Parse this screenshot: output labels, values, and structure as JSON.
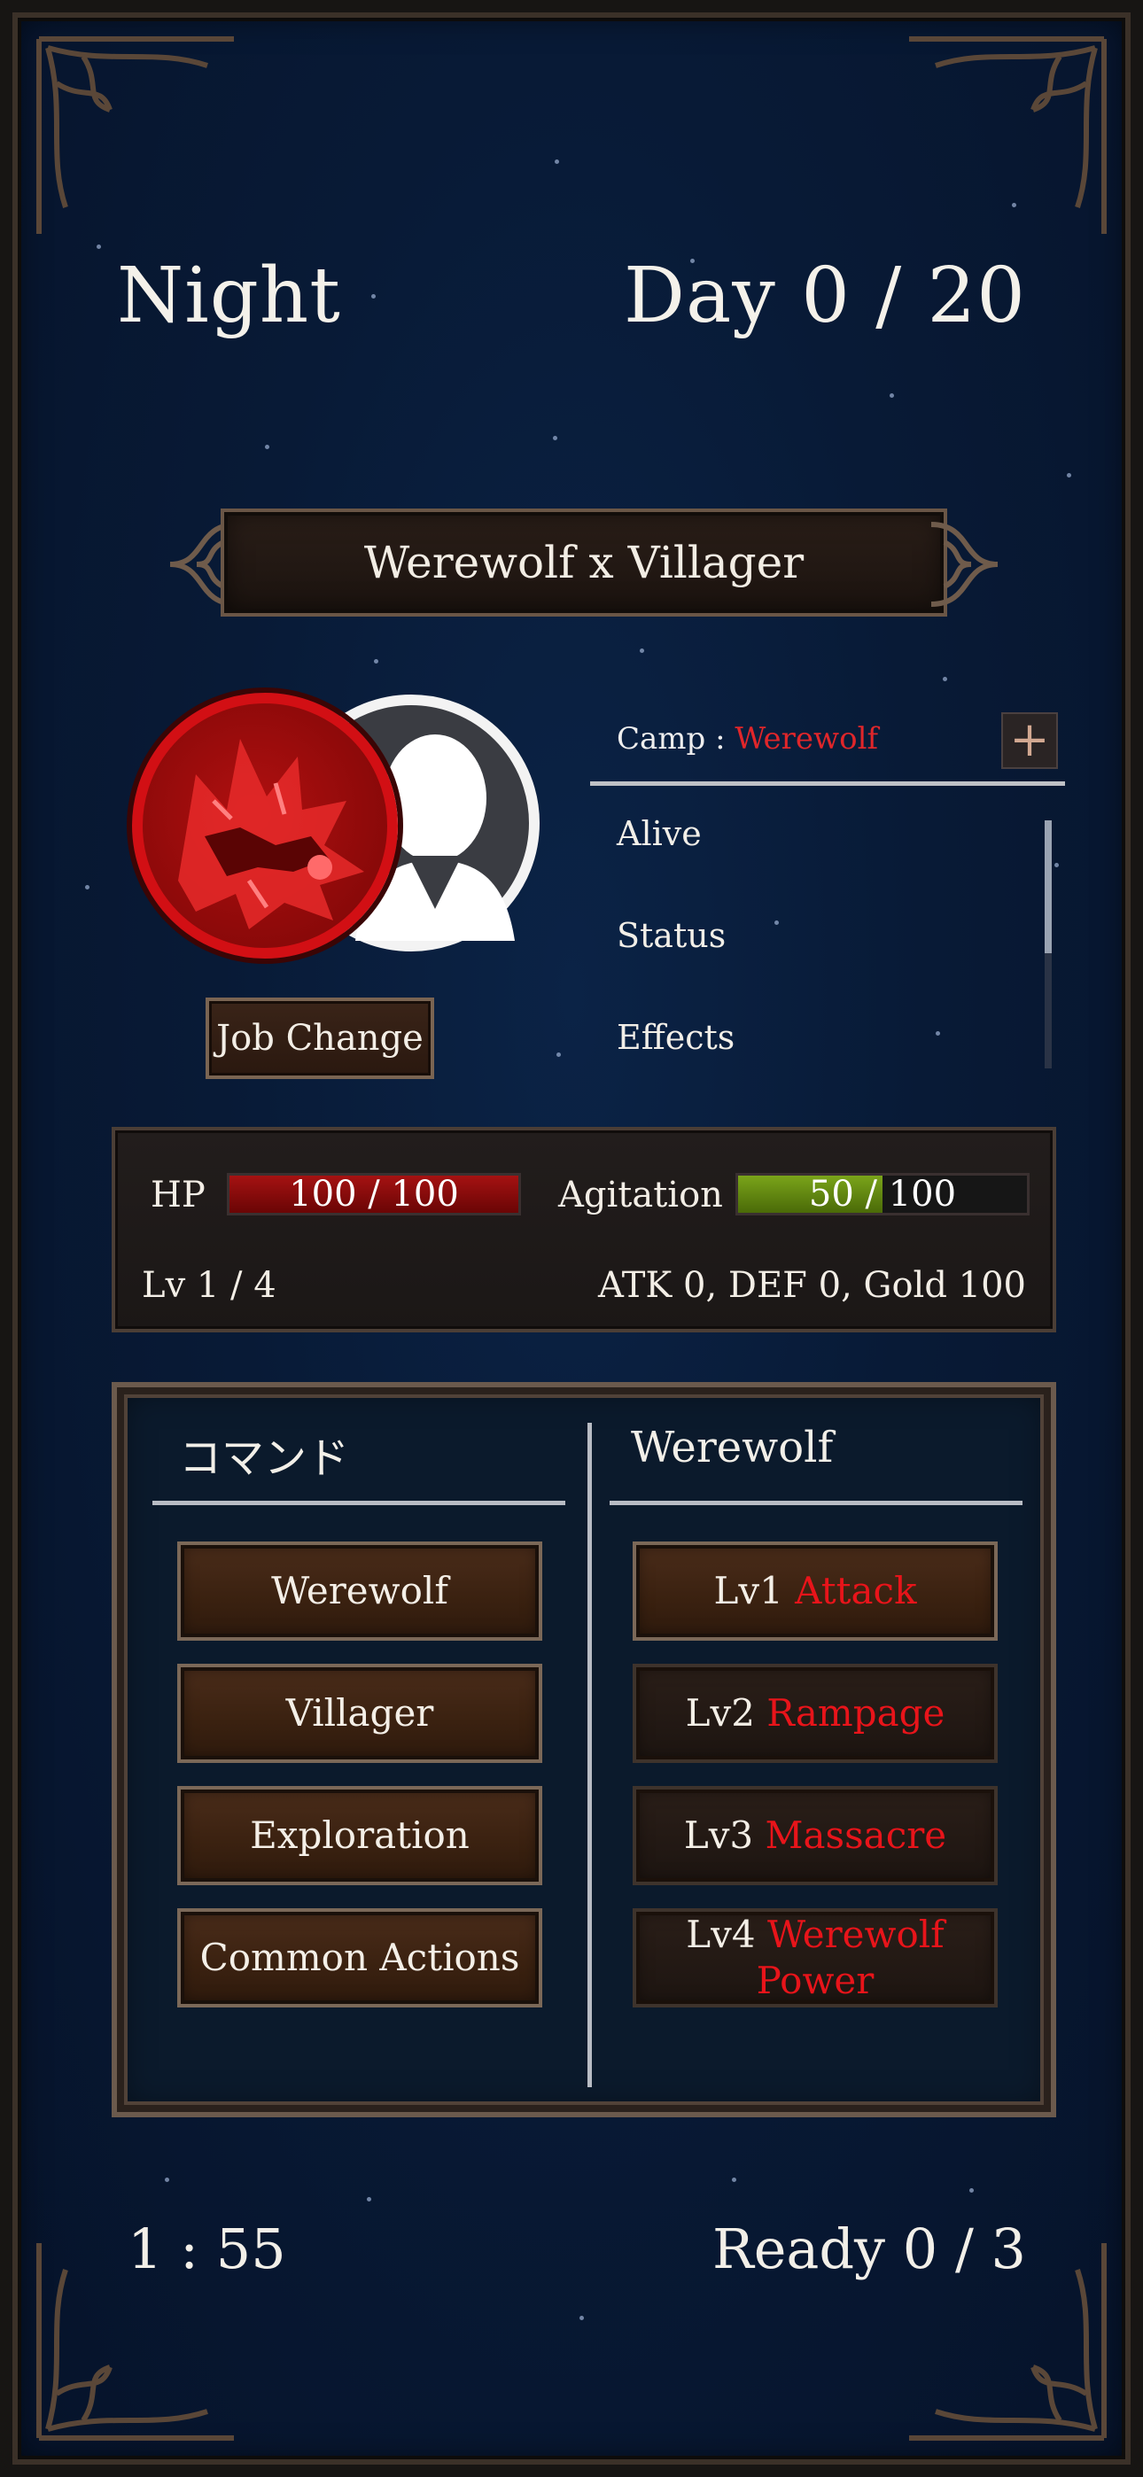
{
  "header": {
    "phase": "Night",
    "day": "Day 0 / 20"
  },
  "banner": {
    "title": "Werewolf x Villager"
  },
  "character": {
    "job_change_label": "Job Change",
    "camp_label": "Camp : ",
    "camp_value": "Werewolf",
    "plus_label": "+",
    "info_items": [
      "Alive",
      "Status",
      "Effects"
    ]
  },
  "stats": {
    "hp_label": "HP",
    "hp_value": "100 / 100",
    "hp_fraction": 1.0,
    "agitation_label": "Agitation",
    "agitation_value": "50 / 100",
    "agitation_fraction": 0.5,
    "level": "Lv 1 / 4",
    "summary": "ATK 0, DEF 0, Gold 100"
  },
  "commands": {
    "left_header": "コマンド",
    "right_header": "Werewolf",
    "left_buttons": [
      "Werewolf",
      "Villager",
      "Exploration",
      "Common Actions"
    ],
    "right_buttons": [
      {
        "level": "Lv1 ",
        "name": "Attack"
      },
      {
        "level": "Lv2 ",
        "name": "Rampage"
      },
      {
        "level": "Lv3 ",
        "name": "Massacre"
      },
      {
        "level": "Lv4 ",
        "name": "Werewolf Power"
      }
    ]
  },
  "footer": {
    "timer": "1 : 55",
    "ready": "Ready 0 / 3"
  },
  "colors": {
    "accent_red": "#e8141a",
    "hp_bar": "#8a0a0a",
    "agitation_bar": "#5b8a10",
    "background": "#081a36"
  },
  "icons": [
    "werewolf-icon",
    "villager-icon",
    "plus-icon"
  ]
}
